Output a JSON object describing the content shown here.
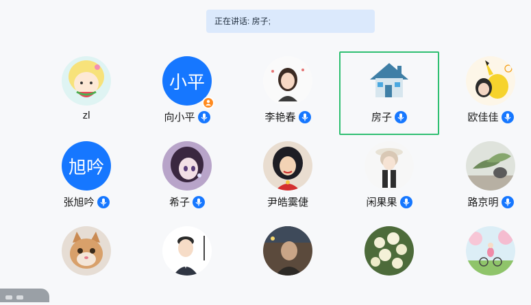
{
  "speaking_banner": {
    "text": "正在讲话: 房子;"
  },
  "participants": [
    {
      "name": "zl",
      "avatar": "cartoon-watermelon-girl",
      "mic": false
    },
    {
      "name": "向小平",
      "avatar_text": "小平",
      "mic": true,
      "host": true
    },
    {
      "name": "李艳春",
      "avatar": "cartoon-girl-portrait",
      "mic": true
    },
    {
      "name": "房子",
      "avatar": "house-icon",
      "mic": true,
      "active": true
    },
    {
      "name": "欧佳佳",
      "avatar": "pikachu-photo",
      "mic": true
    },
    {
      "name": "张旭吟",
      "avatar_text": "旭吟",
      "mic": true
    },
    {
      "name": "希子",
      "avatar": "anime-girl",
      "mic": true
    },
    {
      "name": "尹皓霙倢",
      "avatar": "illustrated-princess",
      "mic": false
    },
    {
      "name": "闲果果",
      "avatar": "anime-boy",
      "mic": true
    },
    {
      "name": "路京明",
      "avatar": "plant-photo",
      "mic": true
    },
    {
      "name": "",
      "avatar": "cat-photo",
      "mic": false
    },
    {
      "name": "",
      "avatar": "cartoon-man-suit",
      "mic": false
    },
    {
      "name": "",
      "avatar": "man-photo",
      "mic": false
    },
    {
      "name": "",
      "avatar": "flowers-photo",
      "mic": false
    },
    {
      "name": "",
      "avatar": "cartoon-bicycle",
      "mic": false
    }
  ],
  "colors": {
    "accent": "#1677ff",
    "active_border": "#2fbf71",
    "banner_bg": "#dbe9fc",
    "host_badge": "#ff8a1f"
  }
}
